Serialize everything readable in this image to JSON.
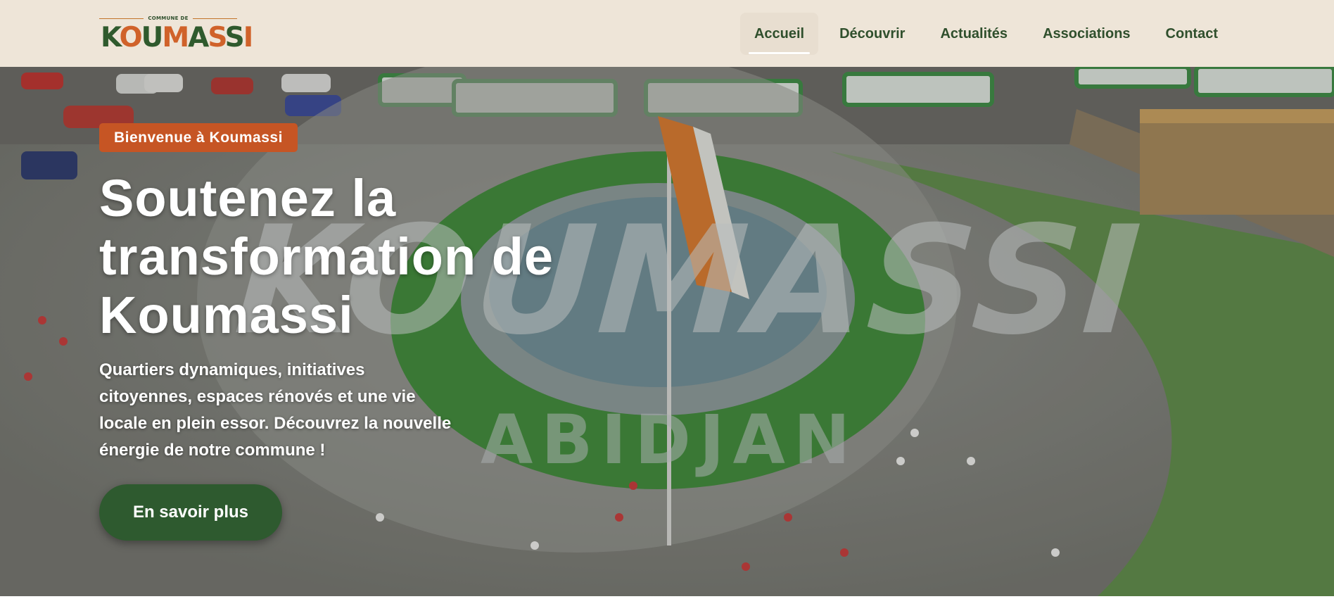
{
  "logo": {
    "small_text": "COMMUNE DE",
    "letters": [
      "K",
      "O",
      "U",
      "M",
      "A",
      "S",
      "S",
      "I"
    ],
    "colors": {
      "green": "#2f5a2d",
      "orange": "#d0622a"
    }
  },
  "nav": {
    "items": [
      {
        "label": "Accueil",
        "active": true
      },
      {
        "label": "Découvrir",
        "active": false
      },
      {
        "label": "Actualités",
        "active": false
      },
      {
        "label": "Associations",
        "active": false
      },
      {
        "label": "Contact",
        "active": false
      }
    ]
  },
  "hero": {
    "badge": "Bienvenue à Koumassi",
    "title_lines": [
      "Soutenez la",
      "transformation de",
      "Koumassi"
    ],
    "description_lines": [
      "Quartiers dynamiques, initiatives",
      "citoyennes, espaces rénovés et une vie",
      "locale en plein essor. Découvrez la nouvelle",
      "énergie de notre commune !"
    ],
    "cta_label": "En savoir plus",
    "watermark_main": "KOUMASSI",
    "watermark_sub": "ABIDJAN"
  },
  "colors": {
    "header_bg": "#eee5d8",
    "nav_text": "#2f4f2c",
    "badge_bg": "#c65524",
    "cta_bg": "#2e5a2f"
  }
}
